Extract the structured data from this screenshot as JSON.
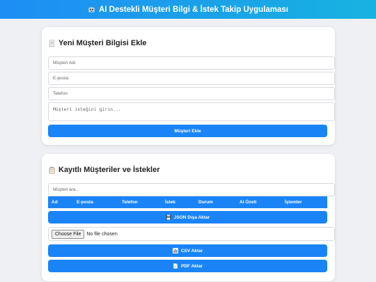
{
  "header": {
    "icon": "robot-icon",
    "title": "AI Destekli Müşteri Bilgi & İstek Takip Uygulaması"
  },
  "add_section": {
    "icon": "receipt-icon",
    "title": "Yeni Müşteri Bilgisi Ekle",
    "name_placeholder": "Müşteri Adı",
    "email_placeholder": "E-posta",
    "phone_placeholder": "Telefon",
    "request_placeholder": "Müşteri isteğini girin...",
    "submit_label": "Müşteri Ekle"
  },
  "list_section": {
    "icon": "clipboard-icon",
    "title": "Kayıtlı Müşteriler ve İstekler",
    "search_placeholder": "Müşteri ara...",
    "columns": [
      "Ad",
      "E-posta",
      "Telefon",
      "İstek",
      "Durum",
      "AI Özeti",
      "İşlemler"
    ],
    "json_export_label": "JSON Dışa Aktar",
    "json_export_icon": "floppy-disk-icon",
    "file_button_label": "Choose File",
    "file_status": "No file chosen",
    "csv_export_label": "CSV Aktar",
    "csv_export_icon": "bar-chart-icon",
    "pdf_export_label": "PDF Aktar",
    "pdf_export_icon": "document-icon"
  },
  "colors": {
    "primary": "#1a84f7",
    "header_gradient_start": "#1d8ef5",
    "header_gradient_end": "#17b3e0",
    "background": "#eef0f3"
  }
}
